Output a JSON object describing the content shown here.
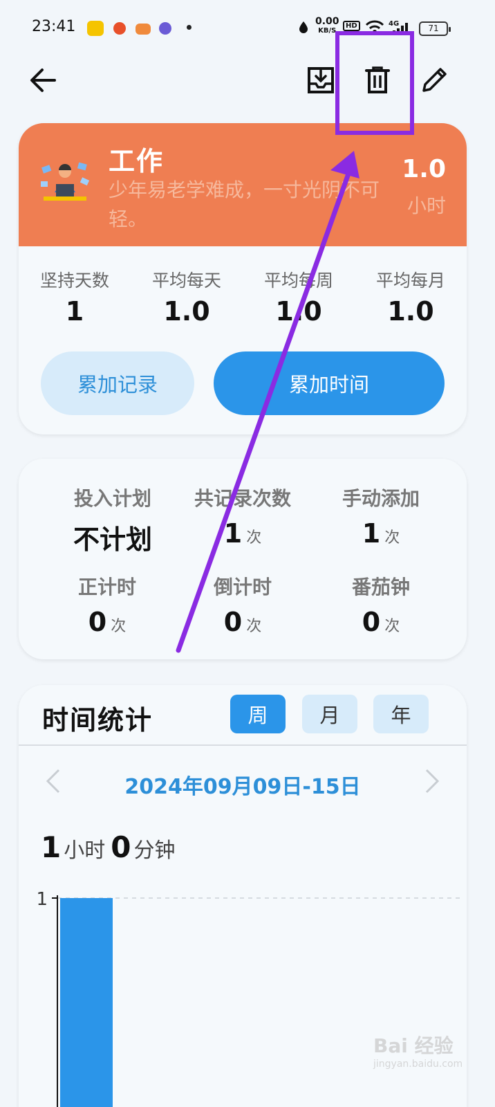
{
  "status_bar": {
    "time": "23:41",
    "net_speed": "0.00",
    "net_unit": "KB/S",
    "hd": "HD",
    "signal": "4G",
    "battery": "71"
  },
  "toolbar": {
    "back_icon": "arrow-left-icon",
    "export_icon": "download-tray-icon",
    "delete_icon": "trash-icon",
    "edit_icon": "pencil-icon"
  },
  "activity": {
    "title": "工作",
    "motto": "少年易老学难成，一寸光阴不可轻。",
    "hours": "1.0",
    "hours_unit": "小时",
    "color": "#ef7e52"
  },
  "summary": [
    {
      "label": "坚持天数",
      "value": "1"
    },
    {
      "label": "平均每天",
      "value": "1.0"
    },
    {
      "label": "平均每周",
      "value": "1.0"
    },
    {
      "label": "平均每月",
      "value": "1.0"
    }
  ],
  "buttons": {
    "add_record": "累加记录",
    "add_time": "累加时间"
  },
  "plan": {
    "investment_label": "投入计划",
    "investment_value": "不计划",
    "total_label": "共记录次数",
    "total_value": "1",
    "manual_label": "手动添加",
    "manual_value": "1",
    "stopwatch_label": "正计时",
    "stopwatch_value": "0",
    "countdown_label": "倒计时",
    "countdown_value": "0",
    "pomodoro_label": "番茄钟",
    "pomodoro_value": "0",
    "unit": "次"
  },
  "time_stats": {
    "title": "时间统计",
    "tabs": [
      "周",
      "月",
      "年"
    ],
    "selected_tab": "周",
    "range": "2024年09月09日-15日",
    "total_hours": "1",
    "hours_unit": "小时",
    "total_minutes": "0",
    "minutes_unit": "分钟"
  },
  "chart_data": {
    "type": "bar",
    "categories": [
      ""
    ],
    "values": [
      1
    ],
    "y_tick_labels": [
      "1"
    ],
    "ylim": [
      0,
      1
    ],
    "bar_color": "#2b95e9",
    "grid": true
  },
  "annotation": {
    "highlight_color": "#8a2be2"
  },
  "watermark": {
    "brand": "Bai 经验",
    "url": "jingyan.baidu.com"
  }
}
